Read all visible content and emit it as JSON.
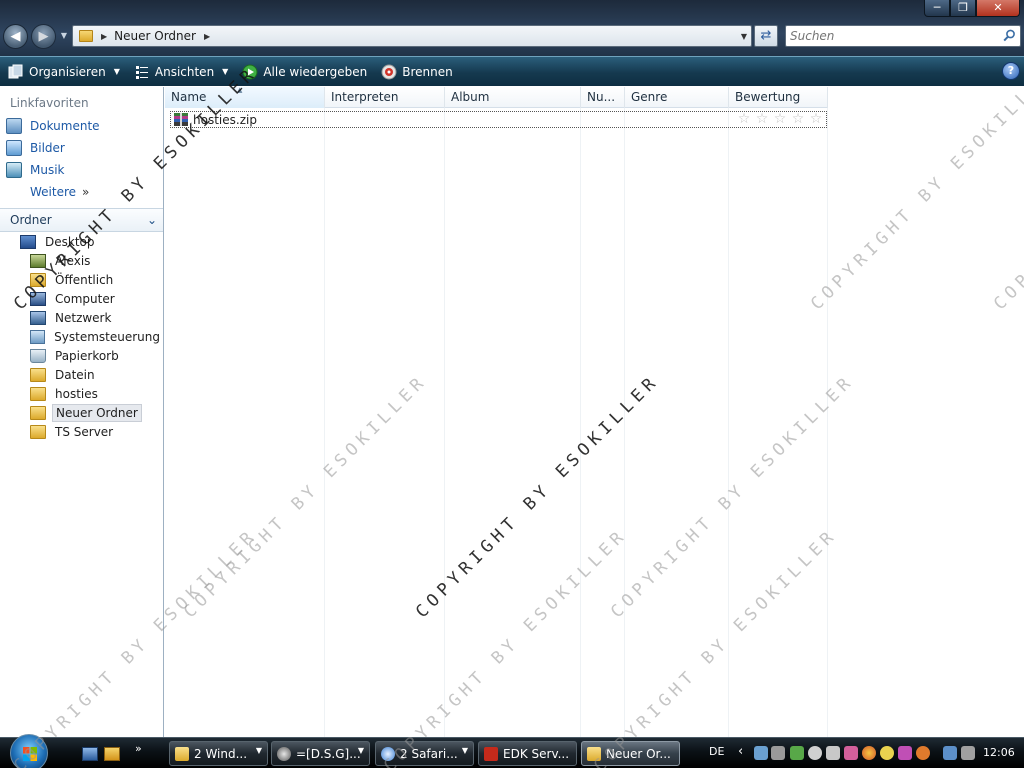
{
  "window": {
    "address_path": "Neuer Ordner",
    "search_placeholder": "Suchen"
  },
  "toolbar": {
    "organize": "Organisieren",
    "views": "Ansichten",
    "play_all": "Alle wiedergeben",
    "burn": "Brennen"
  },
  "navpane": {
    "favorites_title": "Linkfavoriten",
    "favorites": [
      "Dokumente",
      "Bilder",
      "Musik"
    ],
    "more": "Weitere",
    "folders_title": "Ordner",
    "tree": [
      "Desktop",
      "Alexis",
      "Öffentlich",
      "Computer",
      "Netzwerk",
      "Systemsteuerung",
      "Papierkorb",
      "Datein",
      "hosties",
      "Neuer Ordner",
      "TS Server"
    ],
    "selected_index": 9
  },
  "columns": [
    "Name",
    "Interpreten",
    "Album",
    "Nu...",
    "Genre",
    "Bewertung"
  ],
  "files": [
    {
      "name": "hosties.zip",
      "rating": 0,
      "rating_max": 5
    }
  ],
  "watermark_text": "COPYRIGHT BY ESOKILLER",
  "taskbar": {
    "tasks": [
      "2 Wind...",
      "=[D.S.G]...",
      "2 Safari...",
      "EDK Serv...",
      "Neuer Or..."
    ],
    "active_index": 4,
    "language": "DE",
    "clock": "12:06"
  },
  "colors": {
    "link_blue": "#1d59a6",
    "command_bar": "#15394f",
    "taskbar": "#0b1116"
  }
}
